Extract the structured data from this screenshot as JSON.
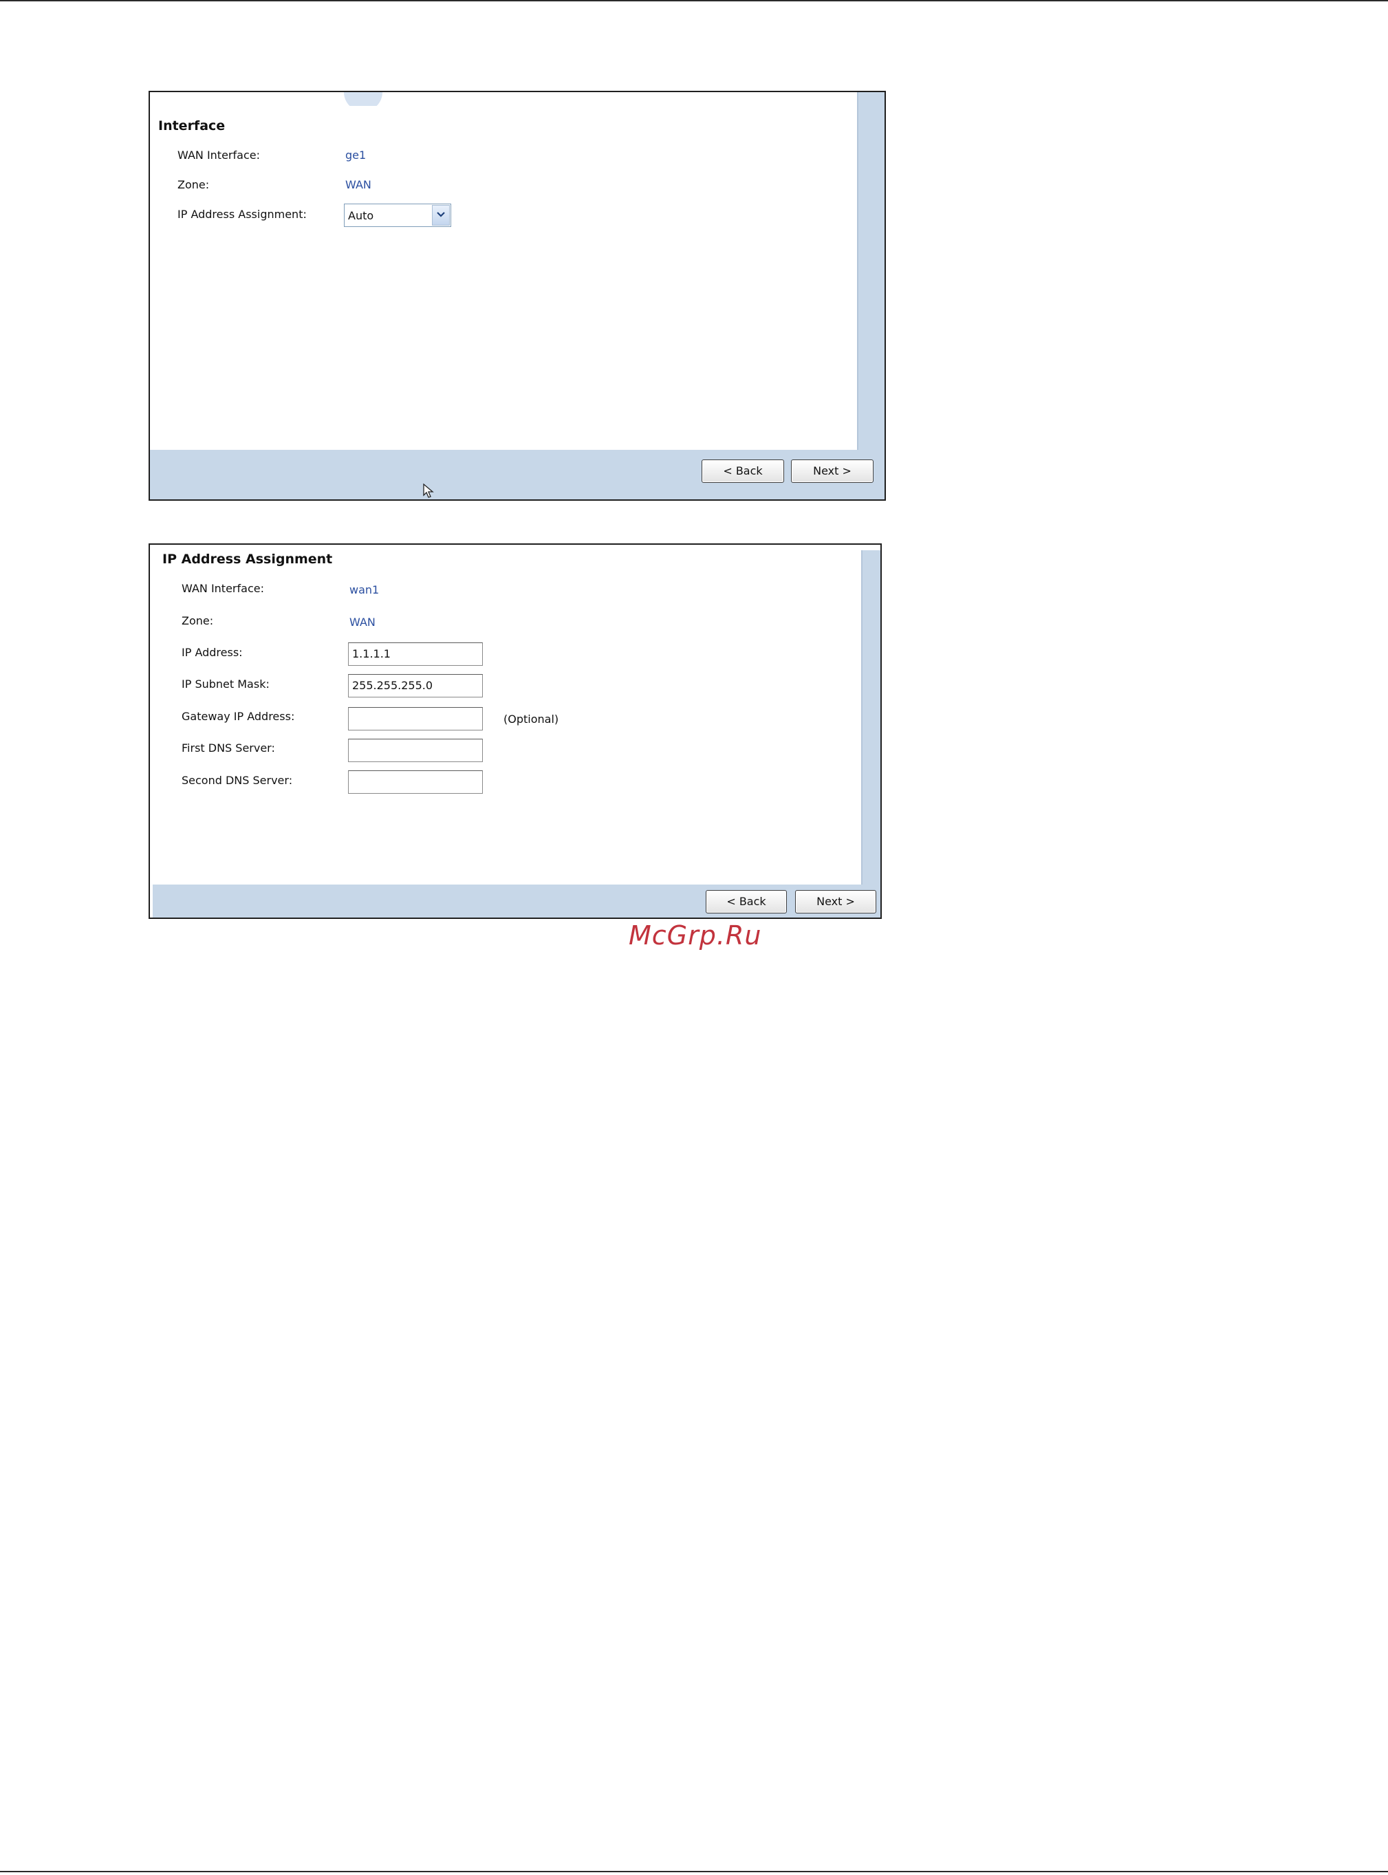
{
  "panel1": {
    "section_title": "Interface",
    "rows": [
      {
        "label": "WAN Interface:",
        "value": "ge1"
      },
      {
        "label": "Zone:",
        "value": "WAN"
      }
    ],
    "ip_assignment": {
      "label": "IP Address Assignment:",
      "selected": "Auto"
    },
    "buttons": {
      "back": "< Back",
      "next": "Next >"
    }
  },
  "panel2": {
    "section_title": "IP Address Assignment",
    "rows": [
      {
        "label": "WAN Interface:",
        "value": "wan1"
      },
      {
        "label": "Zone:",
        "value": "WAN"
      }
    ],
    "fields": [
      {
        "label": "IP Address:",
        "value": "1.1.1.1"
      },
      {
        "label": "IP Subnet Mask:",
        "value": "255.255.255.0"
      },
      {
        "label": "Gateway IP Address:",
        "value": "",
        "hint": "(Optional)"
      },
      {
        "label": "First DNS Server:",
        "value": ""
      },
      {
        "label": "Second DNS Server:",
        "value": ""
      }
    ],
    "buttons": {
      "back": "< Back",
      "next": "Next >"
    }
  },
  "watermark": "McGrp.Ru",
  "colors": {
    "link_value": "#2b4fa0",
    "footer_bg": "#c7d7e8",
    "watermark": "#c2333d"
  },
  "icons": {
    "dropdown": "chevron-down-icon",
    "cursor": "mouse-pointer-icon"
  }
}
